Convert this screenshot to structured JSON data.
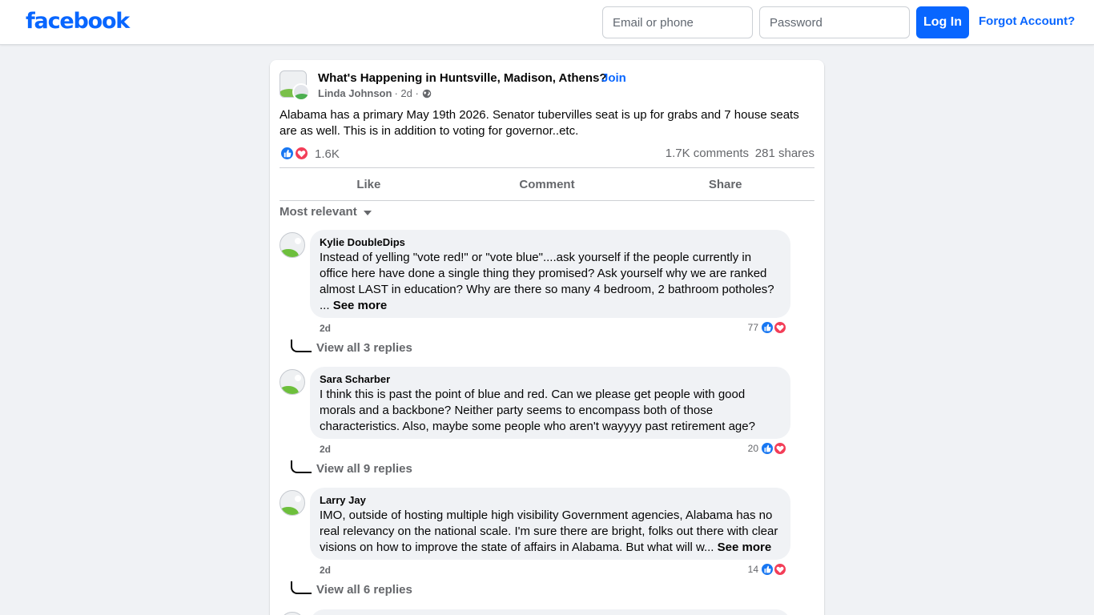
{
  "header": {
    "logo": "facebook",
    "email_placeholder": "Email or phone",
    "password_placeholder": "Password",
    "login_label": "Log In",
    "forgot_label": "Forgot Account?"
  },
  "post": {
    "group_name": "What's Happening in Huntsville, Madison, Athens?",
    "join_separator": "·",
    "join_label": "Join",
    "author": "Linda Johnson",
    "time": "· 2d ·",
    "text": "Alabama has a primary May 19th 2026. Senator tubervilles seat is up for grabs and 7 house seats are as well. This is in addition to voting for governor..etc.",
    "reaction_count": "1.6K",
    "comments_count": "1.7K comments",
    "shares_count": "281 shares",
    "actions": {
      "like": "Like",
      "comment": "Comment",
      "share": "Share"
    },
    "sort_label": "Most relevant"
  },
  "comments": [
    {
      "name": "Kylie DoubleDips",
      "text": "Instead of yelling \"vote red!\" or \"vote blue\"....ask yourself if the people currently in office here have done a single thing they promised? Ask yourself why we are ranked almost LAST in education? Why are there so many 4 bedroom, 2 bathroom potholes? ...",
      "see_more": "See more",
      "time": "2d",
      "reactions": "77",
      "replies": "View all 3 replies"
    },
    {
      "name": "Sara Scharber",
      "text": "I think this is past the point of blue and red. Can we please get people with good morals and a backbone? Neither party seems to encompass both of those characteristics. Also, maybe some people who aren't wayyyy past retirement age?",
      "see_more": "",
      "time": "2d",
      "reactions": "20",
      "replies": "View all 9 replies"
    },
    {
      "name": "Larry Jay",
      "text": "IMO, outside of hosting multiple high visibility Government agencies, Alabama has no real relevancy on the national scale. I'm sure there are bright, folks out there with clear visions on how to improve the state of affairs in Alabama. But what will w...",
      "see_more": "See more",
      "time": "2d",
      "reactions": "14",
      "replies": "View all 6 replies"
    }
  ],
  "colors": {
    "brand": "#0866ff",
    "like": "#1877f2",
    "love": "#f33e58",
    "background": "#f0f2f5"
  }
}
